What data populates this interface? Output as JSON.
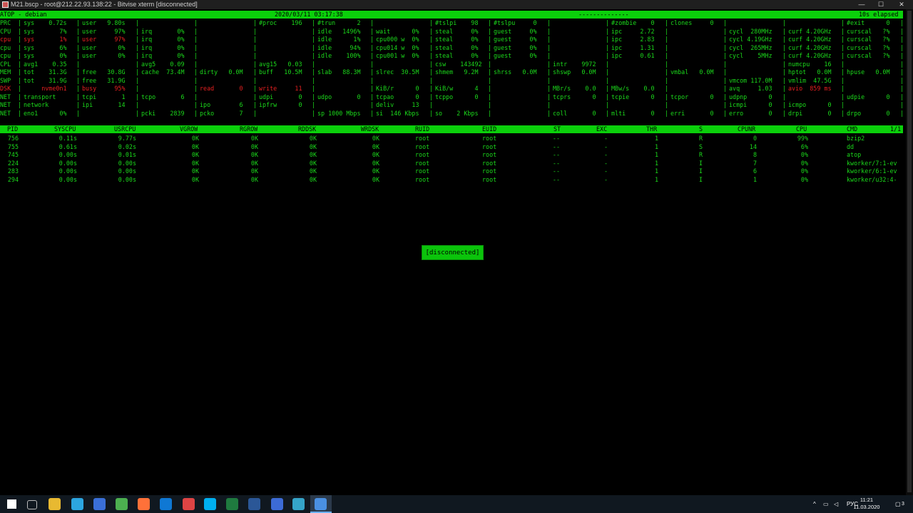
{
  "window": {
    "title": "M21.bscp - root@212.22.93.138:22 - Bitvise xterm [disconnected]",
    "minimize": "—",
    "maximize": "☐",
    "close": "✕"
  },
  "header": {
    "left": "ATOP - debian",
    "datetime": "2020/03/11  03:17:38",
    "dashes": "--------------",
    "elapsed": "10s elapsed"
  },
  "sysrows": [
    {
      "label": "PRC",
      "cells": [
        "sys    0.72s",
        "user   9.80s",
        "",
        "",
        "#proc    196",
        "#trun      2",
        "",
        "#tslpi    98",
        "#tslpu     0",
        "",
        "#zombie    0",
        "clones     0",
        "",
        "",
        "#exit      0"
      ]
    },
    {
      "label": "CPU",
      "cells": [
        "sys       7%",
        "user     97%",
        "irq       0%",
        "",
        "",
        "idle   1496%",
        "wait      0%",
        "steal     0%",
        "guest     0%",
        "",
        "ipc     2.72",
        "",
        "cycl  280MHz",
        "curf 4.20GHz",
        "curscal   ?%"
      ]
    },
    {
      "label": "cpu",
      "red": true,
      "cells": [
        "sys       1%",
        "user     97%",
        "irq       0%",
        "",
        "",
        "idle      1%",
        "cpu000 w  0%",
        "steal     0%",
        "guest     0%",
        "",
        "ipc     2.83",
        "",
        "cycl 4.19GHz",
        "curf 4.20GHz",
        "curscal   ?%"
      ]
    },
    {
      "label": "cpu",
      "cells": [
        "sys       6%",
        "user      0%",
        "irq       0%",
        "",
        "",
        "idle     94%",
        "cpu014 w  0%",
        "steal     0%",
        "guest     0%",
        "",
        "ipc     1.31",
        "",
        "cycl  265MHz",
        "curf 4.20GHz",
        "curscal   ?%"
      ]
    },
    {
      "label": "cpu",
      "cells": [
        "sys       0%",
        "user      0%",
        "irq       0%",
        "",
        "",
        "idle    100%",
        "cpu001 w  0%",
        "steal     0%",
        "guest     0%",
        "",
        "ipc     0.61",
        "",
        "cycl    5MHz",
        "curf 4.20GHz",
        "curscal   ?%"
      ]
    },
    {
      "label": "CPL",
      "cells": [
        "avg1    0.35",
        "",
        "avg5    0.09",
        "",
        "avg15   0.03",
        "",
        "",
        "csw    143492",
        "",
        "intr    9972",
        "",
        "",
        "",
        "numcpu    16",
        ""
      ]
    },
    {
      "label": "MEM",
      "cells": [
        "tot    31.3G",
        "free   30.8G",
        "cache  73.4M",
        "dirty   0.0M",
        "buff   10.5M",
        "slab   88.3M",
        "slrec  30.5M",
        "shmem   9.2M",
        "shrss   0.0M",
        "shswp   0.0M",
        "",
        "vmbal   0.0M",
        "",
        "hptot   0.0M",
        "hpuse   0.0M"
      ]
    },
    {
      "label": "SWP",
      "cells": [
        "tot    31.9G",
        "free   31.9G",
        "",
        "",
        "",
        "",
        "",
        "",
        "",
        "",
        "",
        "",
        "vmcom 117.0M",
        "vmlim  47.5G",
        ""
      ]
    },
    {
      "label": "DSK",
      "red": true,
      "cells": [
        "     nvme0n1",
        "busy     95%",
        "",
        "read       0",
        "write     11",
        "",
        "KiB/r      0",
        "KiB/w      4",
        "",
        "MBr/s    0.0",
        "MBw/s    0.0",
        "",
        "avq     1.03",
        "avio  859 ms",
        ""
      ]
    },
    {
      "label": "NET",
      "cells": [
        "transport",
        "tcpi       1",
        "tcpo       6",
        "",
        "udpi       0",
        "udpo       0",
        "tcpao      0",
        "tcppo      0",
        "",
        "tcprs      0",
        "tcpie      0",
        "tcpor      0",
        "udpnp      0",
        "",
        "udpie      0"
      ]
    },
    {
      "label": "NET",
      "cells": [
        "network",
        "ipi       14",
        "",
        "ipo        6",
        "ipfrw      0",
        "",
        "deliv     13",
        "",
        "",
        "",
        "",
        "",
        "icmpi      0",
        "icmpo      0",
        ""
      ]
    },
    {
      "label": "NET",
      "cells": [
        "eno1      0%",
        "",
        "pcki    2839",
        "pcko       7",
        "",
        "sp 1000 Mbps",
        "si  146 Kbps",
        "so    2 Kbps",
        "",
        "coll       0",
        "mlti       0",
        "erri       0",
        "erro       0",
        "drpi       0",
        "drpo       0"
      ]
    }
  ],
  "proc_header": [
    "PID",
    "SYSCPU",
    "USRCPU",
    "VGROW",
    "RGROW",
    "RDDSK",
    "WRDSK",
    "RUID",
    "EUID",
    "ST",
    "EXC",
    "THR",
    "S",
    "CPUNR",
    "CPU",
    "CMD",
    "1/1"
  ],
  "processes": [
    [
      "756",
      "0.11s",
      "9.77s",
      "0K",
      "0K",
      "0K",
      "0K",
      "root",
      "root",
      "--",
      "-",
      "1",
      "R",
      "0",
      "99%",
      "bzip2"
    ],
    [
      "755",
      "0.61s",
      "0.02s",
      "0K",
      "0K",
      "0K",
      "0K",
      "root",
      "root",
      "--",
      "-",
      "1",
      "S",
      "14",
      "6%",
      "dd"
    ],
    [
      "745",
      "0.00s",
      "0.01s",
      "0K",
      "0K",
      "0K",
      "0K",
      "root",
      "root",
      "--",
      "-",
      "1",
      "R",
      "8",
      "0%",
      "atop"
    ],
    [
      "224",
      "0.00s",
      "0.00s",
      "0K",
      "0K",
      "0K",
      "0K",
      "root",
      "root",
      "--",
      "-",
      "1",
      "I",
      "7",
      "0%",
      "kworker/7:1-ev"
    ],
    [
      "283",
      "0.00s",
      "0.00s",
      "0K",
      "0K",
      "0K",
      "0K",
      "root",
      "root",
      "--",
      "-",
      "1",
      "I",
      "6",
      "0%",
      "kworker/6:1-ev"
    ],
    [
      "294",
      "0.00s",
      "0.00s",
      "0K",
      "0K",
      "0K",
      "0K",
      "root",
      "root",
      "--",
      "-",
      "1",
      "I",
      "1",
      "0%",
      "kworker/u32:4-"
    ]
  ],
  "overlay": {
    "disconnected": "[disconnected]"
  },
  "taskbar": {
    "apps": [
      "windows-start-icon",
      "task-view-icon",
      "file-explorer-icon",
      "telegram-icon",
      "save-disk-icon",
      "chrome-icon",
      "firefox-icon",
      "outlook-icon",
      "photo-app-icon",
      "skype-icon",
      "excel-icon",
      "word-icon",
      "bitvise-sftp-icon",
      "network-app-icon",
      "bitvise-xterm-icon"
    ],
    "lang": "РУС",
    "time": "11:21",
    "date": "11.03.2020",
    "notifications": "3"
  },
  "colors": {
    "terminal_green": "#1bd81b",
    "bar_green": "#0bd00b",
    "alert_red": "#e62020"
  }
}
